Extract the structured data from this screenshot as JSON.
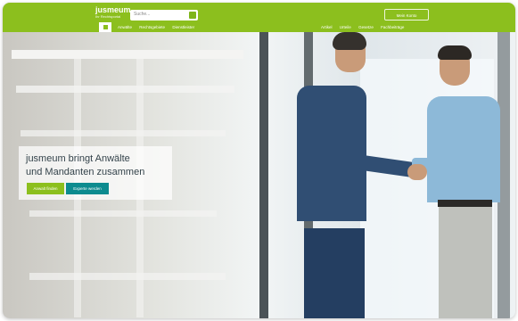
{
  "header": {
    "logo_line1": "jusmeum",
    "logo_line2": "Ihr Rechtsportal",
    "search_placeholder": "Suche...",
    "user_menu": "Mein Konto",
    "nav_left": [
      "Anwälte",
      "Rechtsgebiete",
      "Dienstleister"
    ],
    "nav_right": [
      "Artikel",
      "Urteile",
      "Gesetze",
      "Fachbeiträge"
    ]
  },
  "hero": {
    "headline_line1": "jusmeum bringt Anwälte",
    "headline_line2": "und Mandanten zusammen",
    "primary_button": "Anwalt finden",
    "secondary_button": "Experte werden"
  },
  "colors": {
    "brand_green": "#8cbf1e",
    "teal": "#0d8b8f"
  },
  "icons": [
    "home-icon",
    "search-icon",
    "user-icon"
  ]
}
